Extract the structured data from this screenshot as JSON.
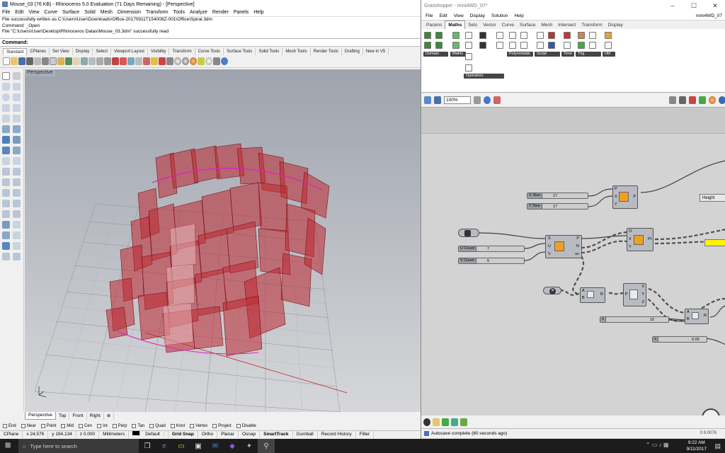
{
  "rhino": {
    "title": "Mouse_03 (76 KB) - Rhinoceros 5.0 Evaluation (71 Days Remaining) - [Perspective]",
    "menu": [
      "File",
      "Edit",
      "View",
      "Curve",
      "Surface",
      "Solid",
      "Mesh",
      "Dimension",
      "Transform",
      "Tools",
      "Analyze",
      "Render",
      "Panels",
      "Help"
    ],
    "history": [
      "File successfully written as C:\\Users\\User\\Downloads\\Office-20170911T154008Z-001\\Office\\Spiral.3dm",
      "Command: _Open",
      "File \"C:\\Users\\User\\Desktop\\Rhinoceros Datas\\Mouse_03.3dm\" successfully read"
    ],
    "command_prompt": "Command:",
    "toolbar_tabs": [
      "Standard",
      "CPlanes",
      "Set View",
      "Display",
      "Select",
      "Viewport Layout",
      "Visibility",
      "Transform",
      "Curve Tools",
      "Surface Tools",
      "Solid Tools",
      "Mesh Tools",
      "Render Tools",
      "Drafting",
      "New in V5"
    ],
    "viewport_label": "Perspective",
    "viewport_tabs": [
      "Perspective",
      "Top",
      "Front",
      "Right"
    ],
    "osnaps": [
      "End",
      "Near",
      "Point",
      "Mid",
      "Cen",
      "Int",
      "Perp",
      "Tan",
      "Quad",
      "Knot",
      "Vertex",
      "Project",
      "Disable"
    ],
    "status": {
      "cplane": "CPlane",
      "x": "x 24.576",
      "y": "y 194.134",
      "z": "z 0.000",
      "units": "Millimeters",
      "layer": "Default",
      "toggles": [
        "Grid Snap",
        "Ortho",
        "Planar",
        "Osnap",
        "SmartTrack",
        "Gumball",
        "Record History",
        "Filter"
      ]
    }
  },
  "grasshopper": {
    "title": "Grasshopper - mini4WD_07*",
    "menu": [
      "File",
      "Edit",
      "View",
      "Display",
      "Solution",
      "Help"
    ],
    "doc_name": "mini4WD_07",
    "category_tabs": [
      "Params",
      "Maths",
      "Sets",
      "Vector",
      "Curve",
      "Surface",
      "Mesh",
      "Intersect",
      "Transform",
      "Display"
    ],
    "ribbon_groups": [
      "Domain",
      "Matrix",
      "Operators",
      "Polynomials",
      "Script",
      "Time",
      "Trig",
      "Util"
    ],
    "zoom": "100%",
    "sliders": {
      "xsize": {
        "label": "X Size",
        "value": "17"
      },
      "ysize": {
        "label": "Y Size",
        "value": "17"
      },
      "ucount": {
        "label": "U Count",
        "value": "7"
      },
      "vcount": {
        "label": "V Count",
        "value": "5"
      },
      "ten": {
        "value": "10"
      },
      "small": {
        "value": "0.09"
      }
    },
    "panel_height": "Height",
    "status_text": "Autosave complete (80 seconds ago)",
    "version": "0.9.0076"
  },
  "taskbar": {
    "search_placeholder": "Type here to search",
    "time": "9:22 AM",
    "date": "9/11/2017"
  }
}
